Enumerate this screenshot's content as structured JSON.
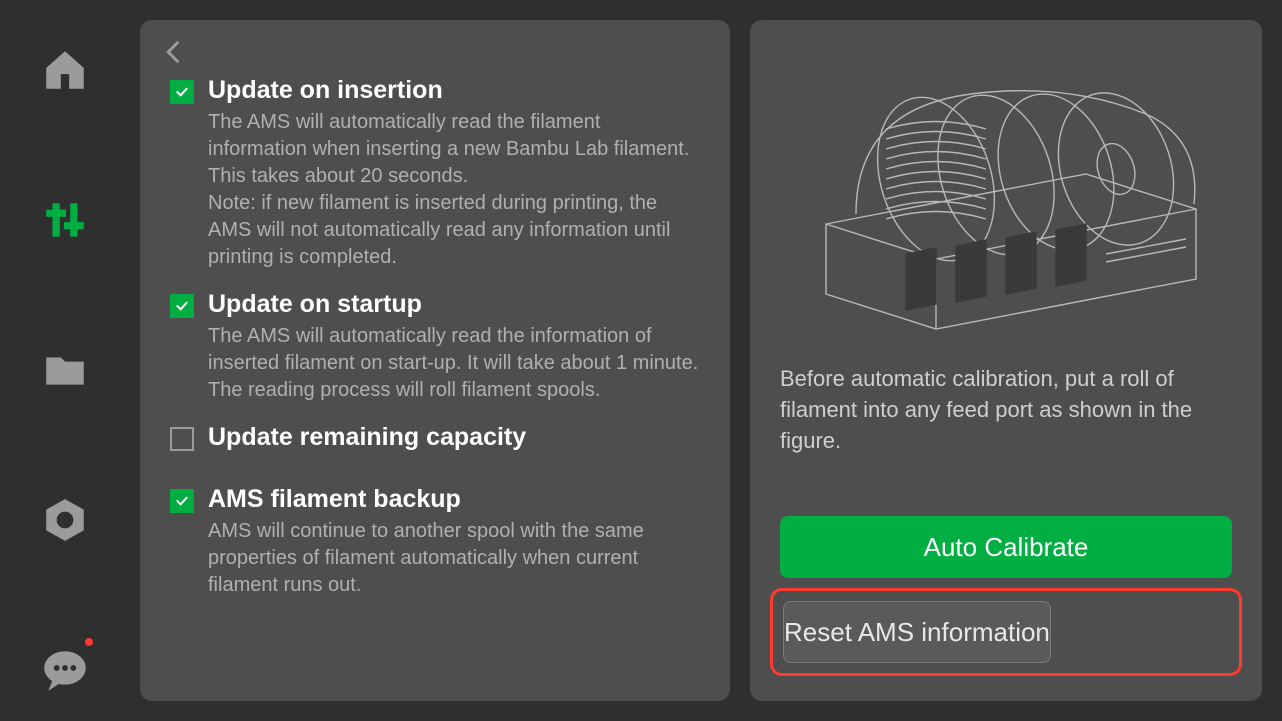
{
  "sidebar": {
    "items": [
      {
        "name": "home",
        "active": false
      },
      {
        "name": "settings-sliders",
        "active": true
      },
      {
        "name": "files",
        "active": false
      },
      {
        "name": "settings-hex",
        "active": false
      },
      {
        "name": "chat",
        "active": false,
        "badge": true
      }
    ]
  },
  "options": [
    {
      "key": "update_insertion",
      "checked": true,
      "title": "Update on insertion",
      "desc": "The AMS will automatically read the filament information when inserting a new Bambu Lab filament. This takes about 20 seconds.\nNote: if new filament is inserted during  printing, the AMS will not automatically read any information until printing is completed."
    },
    {
      "key": "update_startup",
      "checked": true,
      "title": "Update on startup",
      "desc": "The AMS will automatically read the information of inserted filament on start-up. It will take about 1 minute.\nThe reading process will roll filament spools."
    },
    {
      "key": "update_capacity",
      "checked": false,
      "title": "Update remaining capacity",
      "desc": ""
    },
    {
      "key": "ams_backup",
      "checked": true,
      "title": "AMS filament backup",
      "desc": "AMS will continue to another spool with the same properties of filament automatically when current filament runs out."
    }
  ],
  "right": {
    "caption": "Before automatic calibration, put a roll of filament into any feed port as shown in the figure.",
    "calibrate_label": "Auto Calibrate",
    "reset_label": "Reset AMS information"
  }
}
